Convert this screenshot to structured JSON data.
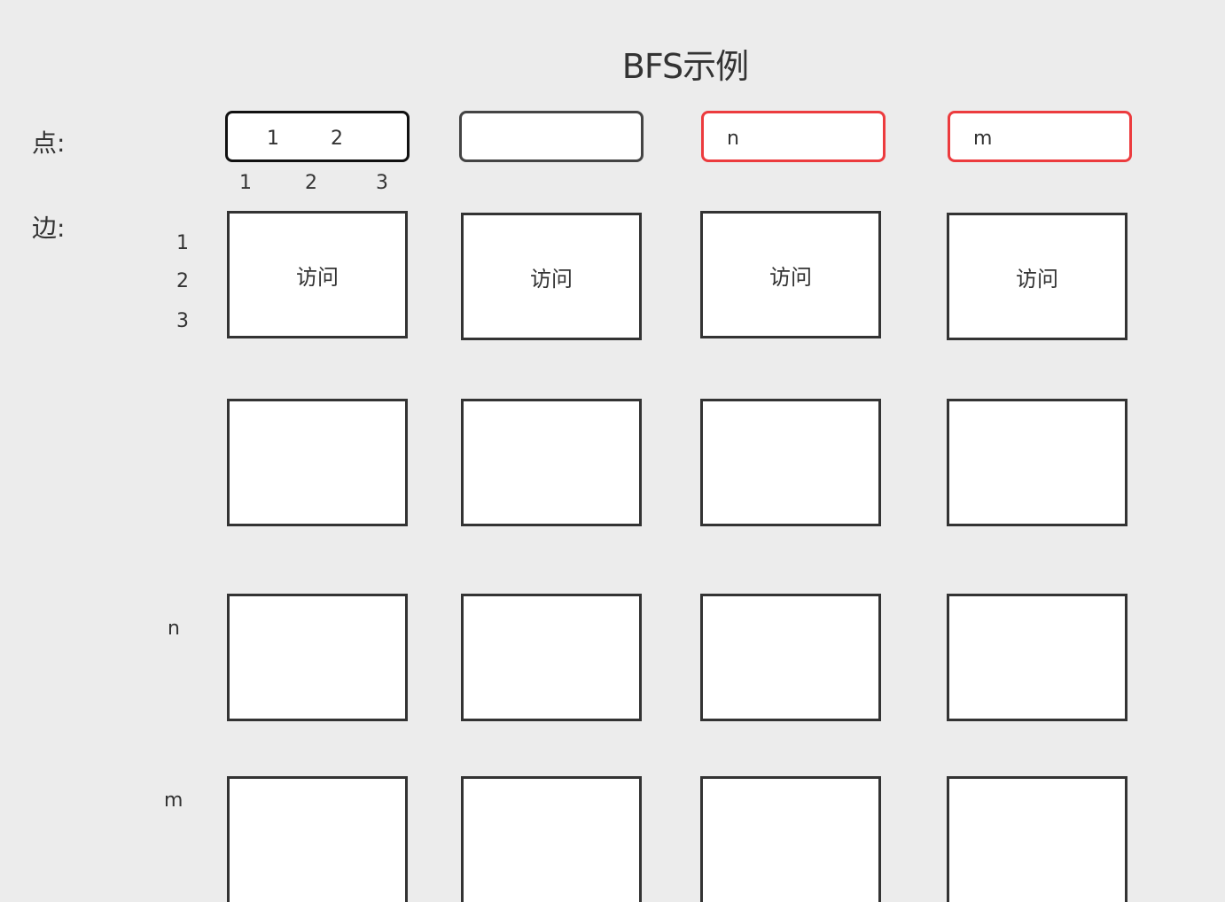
{
  "title": "BFS示例",
  "labels": {
    "nodes": "点:",
    "edges": "边:"
  },
  "node_inputs": [
    {
      "values": [
        "1",
        "2"
      ]
    },
    {
      "values": []
    },
    {
      "values": [
        "n"
      ]
    },
    {
      "values": [
        "m"
      ]
    }
  ],
  "node_index": [
    "1",
    "2",
    "3"
  ],
  "edge_index_top": [
    "1",
    "2",
    "3"
  ],
  "edge_row_labels": [
    "",
    "",
    "n",
    "m"
  ],
  "cell_label": "访问",
  "colors": {
    "background": "#ececec",
    "box_border": "#333333",
    "highlight_border": "#ec3b3e",
    "box_fill": "#ffffff"
  }
}
